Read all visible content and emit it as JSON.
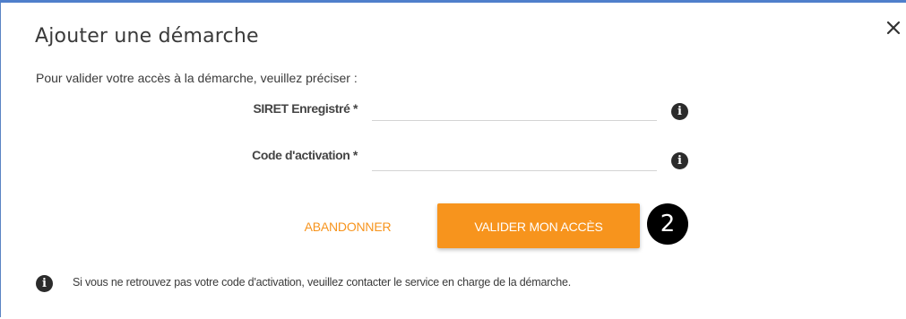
{
  "dialog": {
    "title": "Ajouter une démarche",
    "close_icon": "close-icon",
    "intro": "Pour valider votre accès à la démarche, veuillez préciser :"
  },
  "form": {
    "siret": {
      "label": "SIRET Enregistré *",
      "value": "",
      "info_icon": "info-icon"
    },
    "code": {
      "label": "Code d'activation *",
      "value": "",
      "info_icon": "info-icon"
    }
  },
  "actions": {
    "abandon_label": "ABANDONNER",
    "submit_label": "VALIDER MON ACCÈS",
    "step_badge": "2"
  },
  "notice": {
    "icon": "info-icon",
    "text": "Si vous ne retrouvez pas votre code d'activation, veuillez contacter le service en charge de la démarche."
  },
  "colors": {
    "accent": "#f7941d",
    "border": "#4f7fcb",
    "text": "#3a3a3a",
    "icon": "#2b2b2b"
  }
}
